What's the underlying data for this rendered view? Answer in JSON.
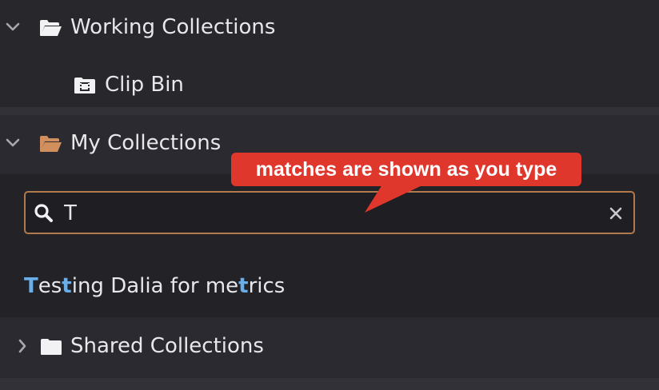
{
  "tree": {
    "working": {
      "label": "Working Collections",
      "icon": "folder-open-icon",
      "expanded": true
    },
    "clip_bin": {
      "label": "Clip Bin",
      "icon": "film-bin-icon"
    },
    "my": {
      "label": "My Collections",
      "icon": "folder-open-icon",
      "expanded": true,
      "icon_color": "#d28f5e"
    },
    "shared": {
      "label": "Shared Collections",
      "icon": "folder-icon",
      "expanded": false
    }
  },
  "search": {
    "value": "T",
    "placeholder": ""
  },
  "result": {
    "parts": [
      {
        "text": "T",
        "match": true
      },
      {
        "text": "es",
        "match": false
      },
      {
        "text": "t",
        "match": true
      },
      {
        "text": "ing Dalia for me",
        "match": false
      },
      {
        "text": "t",
        "match": true
      },
      {
        "text": "rics",
        "match": false
      }
    ]
  },
  "tooltip": {
    "text": "matches are shown as you type"
  },
  "colors": {
    "background": "#28272c",
    "accent_border": "#b07a4e",
    "tooltip": "#e0372d",
    "match": "#69aee8"
  }
}
